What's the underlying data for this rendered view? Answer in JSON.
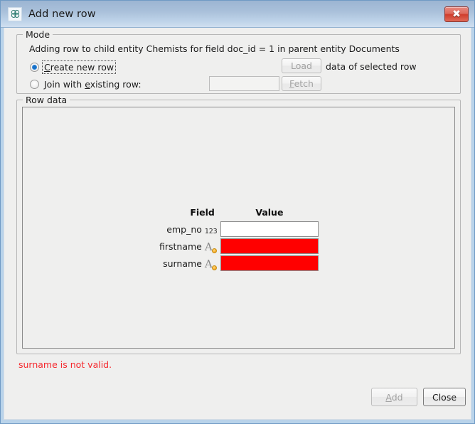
{
  "window": {
    "title": "Add new row",
    "icon": "app-flower-icon",
    "close_label": "✖"
  },
  "mode": {
    "group_title": "Mode",
    "description": "Adding row to child entity Chemists for field doc_id = 1 in parent entity Documents",
    "options": [
      {
        "label_before": "C",
        "label_underline": "",
        "label": "Create new row",
        "selected": true,
        "mnemonic": "C"
      },
      {
        "label": "Join with existing row:",
        "selected": false,
        "mnemonic": "e"
      }
    ],
    "create_label": "Create new row",
    "join_label": "Join with existing row:",
    "join_input_value": "",
    "join_input_placeholder": "",
    "load_button": "Load",
    "fetch_button": "Fetch",
    "load_note": "data of selected row"
  },
  "row_data": {
    "group_title": "Row data",
    "headers": {
      "field": "Field",
      "value": "Value"
    },
    "rows": [
      {
        "field": "emp_no",
        "type_icon": "number-type-icon",
        "type_glyph": "123",
        "value": "",
        "invalid": false
      },
      {
        "field": "firstname",
        "type_icon": "text-type-icon",
        "type_glyph": "A",
        "value": "",
        "invalid": true
      },
      {
        "field": "surname",
        "type_icon": "text-type-icon",
        "type_glyph": "A",
        "value": "",
        "invalid": true
      }
    ]
  },
  "status": {
    "error_message": "surname is not valid.",
    "error_color": "#f5282d"
  },
  "footer": {
    "add_button": "Add",
    "close_button": "Close",
    "add_enabled": false,
    "close_enabled": true
  },
  "colors": {
    "title_bar_top": "#9cb5d2",
    "title_bar_bottom": "#cfdff0",
    "frame": "#b9d3ea",
    "client_bg": "#efefee",
    "invalid_cell": "#ff0000",
    "close_button": "#cf3d2c"
  }
}
